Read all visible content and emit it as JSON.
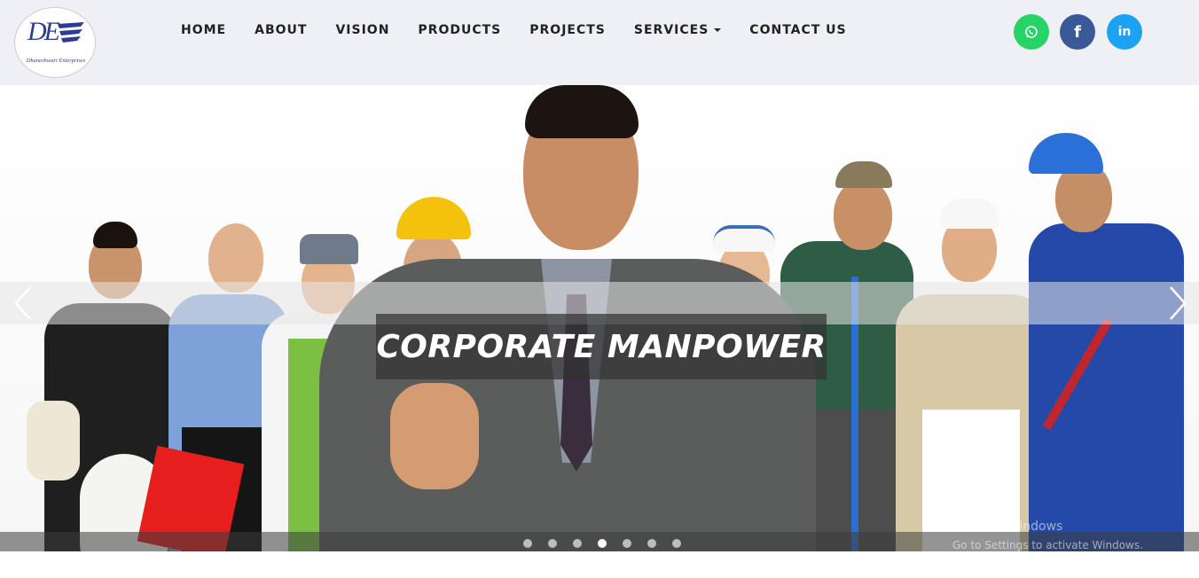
{
  "logo": {
    "mark": "DE",
    "tagline": "Dhaneshwari Enterprises"
  },
  "nav": {
    "items": [
      {
        "label": "HOME"
      },
      {
        "label": "ABOUT"
      },
      {
        "label": "VISION"
      },
      {
        "label": "PRODUCTS"
      },
      {
        "label": "PROJECTS"
      },
      {
        "label": "SERVICES"
      },
      {
        "label": "CONTACT US"
      }
    ]
  },
  "social": {
    "whatsapp": {
      "icon": "whatsapp-icon",
      "color": "#25d366"
    },
    "facebook": {
      "icon": "facebook-icon",
      "glyph": "f",
      "color": "#3b5998"
    },
    "linkedin": {
      "icon": "linkedin-icon",
      "glyph": "in",
      "color": "#1da1f2"
    }
  },
  "hero": {
    "caption": "CORPORATE MANPOWER",
    "prev_icon": "chevron-left-icon",
    "next_icon": "chevron-right-icon",
    "slide_count": 7,
    "active_slide": 4
  },
  "watermark": {
    "title": "Activate Windows",
    "subtitle": "Go to Settings to activate Windows."
  },
  "colors": {
    "header_bg": "#eef0f5",
    "nav_text": "#222222",
    "caption_bg": "#323232"
  }
}
